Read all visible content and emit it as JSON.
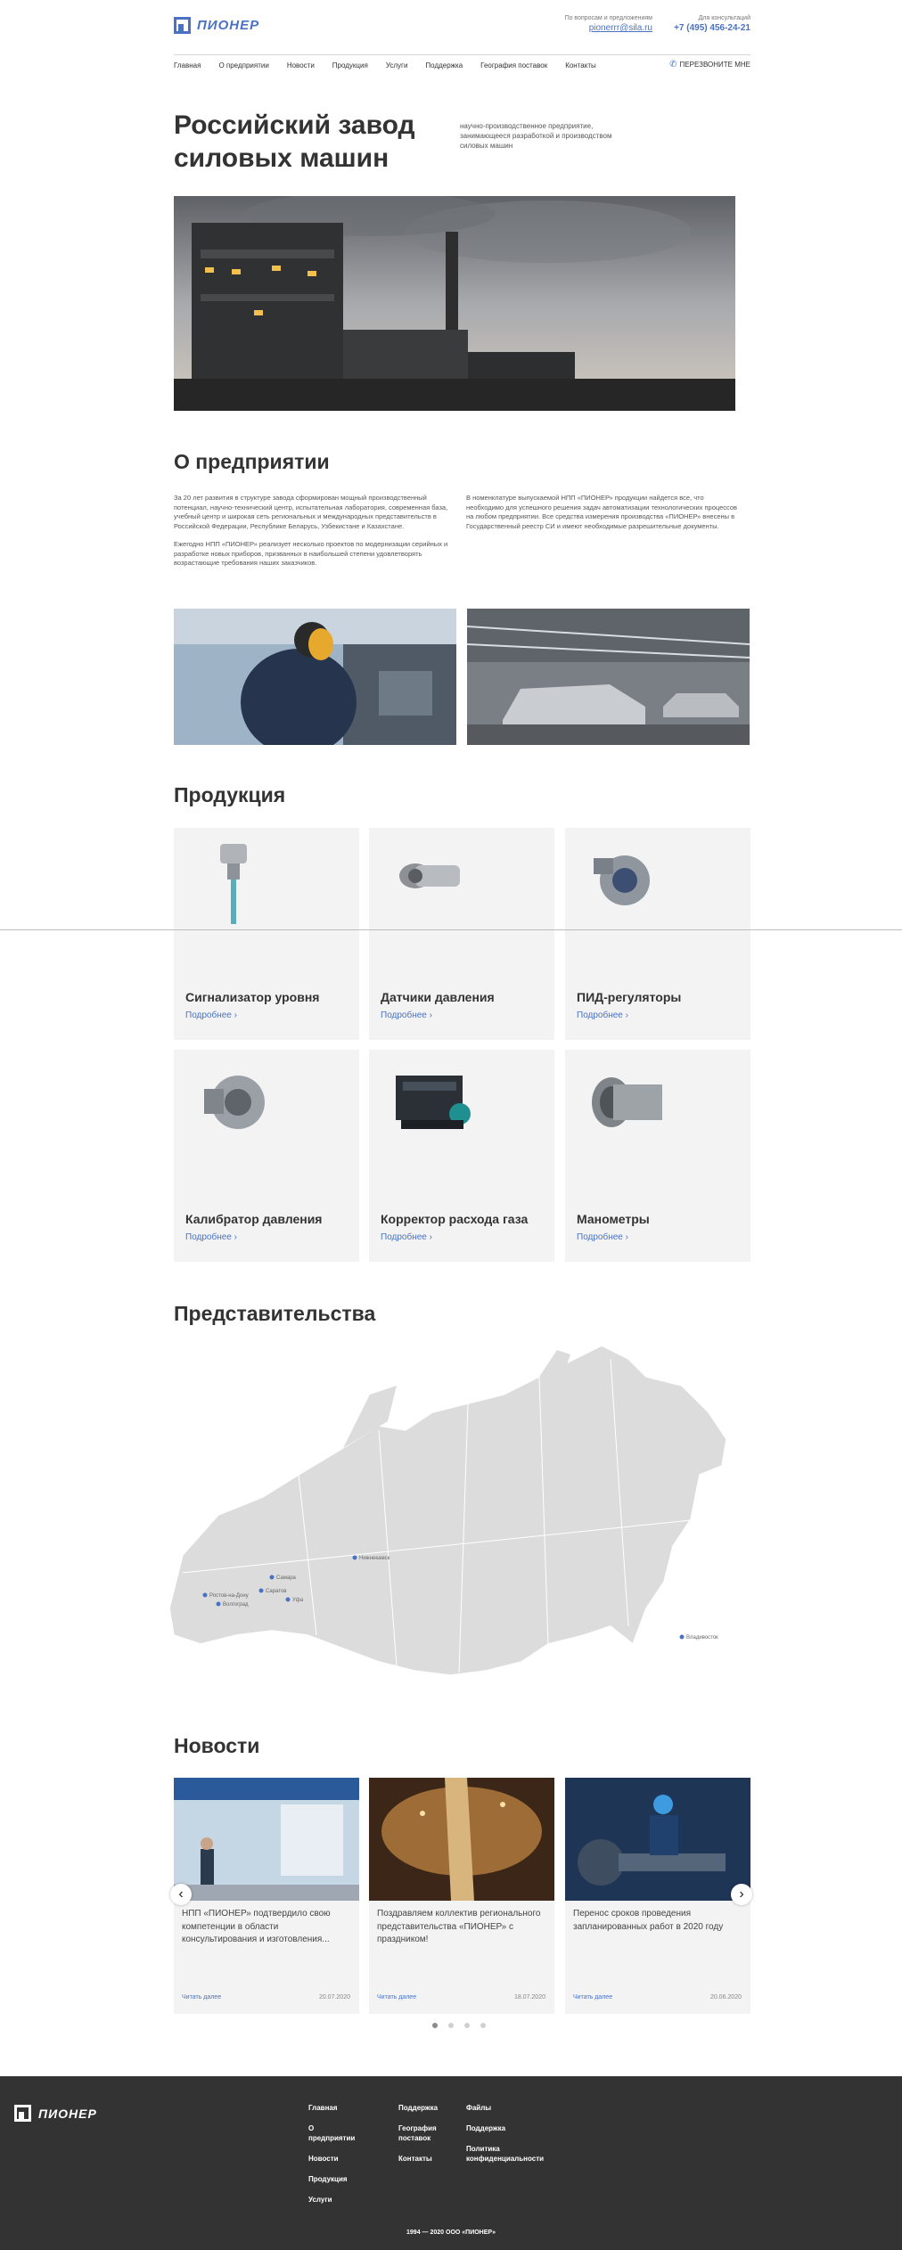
{
  "header": {
    "logo": "ПИОНЕР",
    "mail_caption": "По вопросам и предложениям",
    "mail": "pionerrr@sila.ru",
    "phone_caption": "Для консультаций",
    "phone": "+7 (495) 456-24-21"
  },
  "nav": {
    "items": [
      "Главная",
      "О предприятии",
      "Новости",
      "Продукция",
      "Услуги",
      "Поддержка",
      "География поставок",
      "Контакты"
    ],
    "callback": "ПЕРЕЗВОНИТЕ МНЕ"
  },
  "hero": {
    "title": "Российский завод силовых машин",
    "subtitle": "научно-производственное предприятие, занимающееся разработкой и производством силовых машин"
  },
  "about": {
    "title": "О предприятии",
    "col1_p1": "За 20 лет развития в структуре завода сформирован мощный производственный потенциал, научно-технический центр, испытательная лаборатория, современная база, учебный центр и широкая сеть региональных и международных представительств в Российской Федерации, Республике Беларусь, Узбекистане и Казахстане.",
    "col1_p2": "Ежегодно НПП «ПИОНЕР» реализует несколько проектов по модернизации серийных и разработке новых приборов, призванных в наибольшей степени удовлетворять возрастающие требования наших заказчиков.",
    "col2_p1": "В номенклатуре выпускаемой НПП «ПИОНЕР» продукции найдется все, что необходимо для успешного решения задач автоматизации технологических процессов на любом предприятии. Все средства измерения производства «ПИОНЕР» внесены в Государственный реестр СИ и имеют необходимые разрешительные документы."
  },
  "products": {
    "title": "Продукция",
    "more_label": "Подробнее ›",
    "items": [
      {
        "name": "Сигнализатор уровня"
      },
      {
        "name": "Датчики давления"
      },
      {
        "name": "ПИД-регуляторы"
      },
      {
        "name": "Калибратор давления"
      },
      {
        "name": "Корректор расхода газа"
      },
      {
        "name": "Манометры"
      }
    ]
  },
  "offices": {
    "title": "Представительства",
    "cities": [
      "Нижнекамск",
      "Ростов-на-Дону",
      "Волгоград",
      "Самара",
      "Саратов",
      "Уфа",
      "Владивосток"
    ]
  },
  "news": {
    "title": "Новости",
    "read_more": "Читать далее",
    "items": [
      {
        "text": "НПП «ПИОНЕР» подтвердило свою компетенции в области консультирования и изготовления...",
        "date": "20.07.2020"
      },
      {
        "text": "Поздравляем коллектив регионального представительства «ПИОНЕР» с праздником!",
        "date": "18.07.2020"
      },
      {
        "text": "Перенос сроков проведения запланированных работ в 2020 году",
        "date": "20.06.2020"
      }
    ]
  },
  "footer": {
    "logo": "ПИОНЕР",
    "col1": [
      "Главная",
      "О предприятии",
      "Новости",
      "Продукция",
      "Услуги"
    ],
    "col2": [
      "Поддержка",
      "География поставок",
      "Контакты"
    ],
    "col3": [
      "Файлы",
      "Поддержка",
      "Политика конфиденциальности"
    ],
    "copyright": "1994 — 2020 ООО «ПИОНЕР»"
  },
  "colors": {
    "accent": "#4a72c4",
    "footer_bg": "#333333",
    "card_bg": "#f3f3f3"
  }
}
